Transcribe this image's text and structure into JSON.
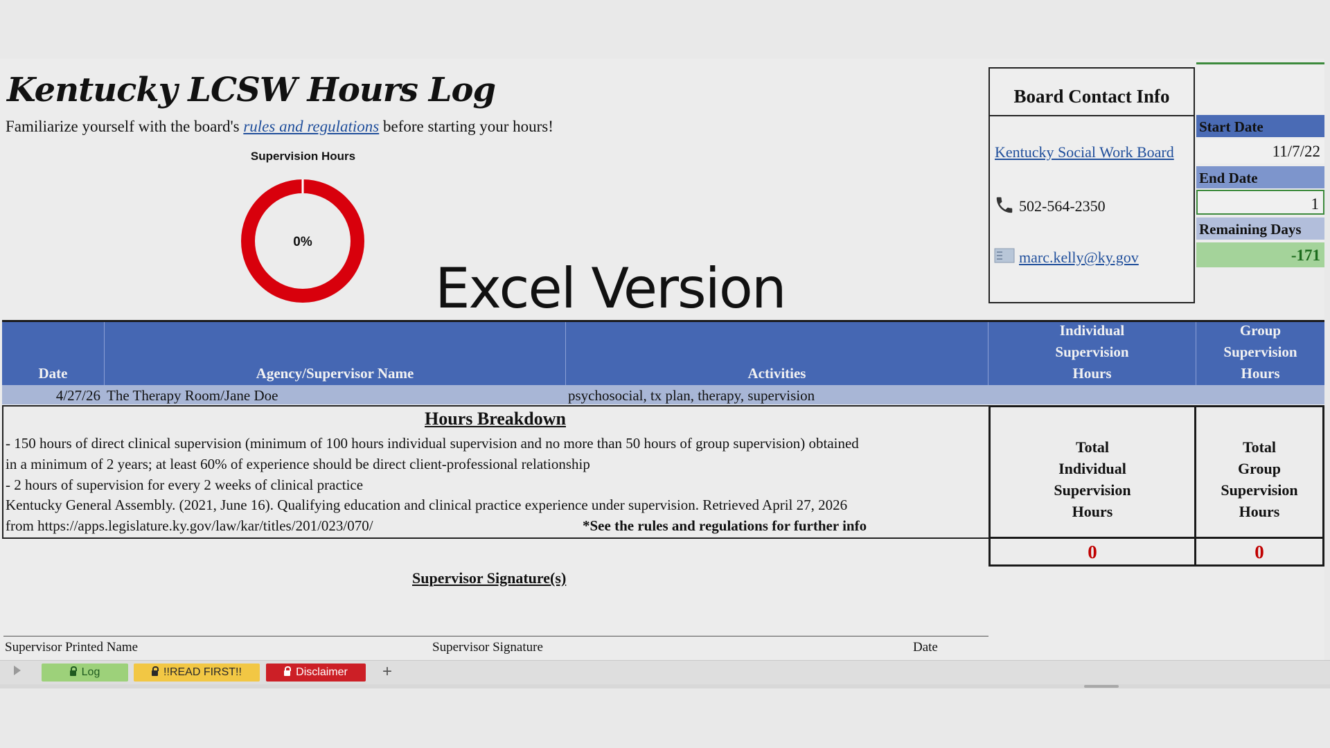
{
  "title": "Kentucky LCSW Hours Log",
  "intro": {
    "prefix": "Familiarize yourself with the board's ",
    "link": "rules and regulations",
    "suffix": " before starting your hours!"
  },
  "chart_data": {
    "type": "pie",
    "title": "Supervision Hours",
    "center_label": "0%",
    "values": [
      0,
      100
    ],
    "colors": [
      "#f0f0f0",
      "#d8000c"
    ]
  },
  "overlay_text": "Excel Version",
  "contact": {
    "heading": "Board Contact Info",
    "board_link": "Kentucky Social Work Board",
    "phone": "502-564-2350",
    "email": "marc.kelly@ky.gov"
  },
  "dates": {
    "start_label": "Start Date",
    "start_value": "11/7/22",
    "end_label": "End Date",
    "end_value": "1",
    "remaining_label": "Remaining Days",
    "remaining_value": "-171"
  },
  "table": {
    "headers": {
      "date": "Date",
      "agency": "Agency/Supervisor Name",
      "activities": "Activities",
      "individual": "Individual\nSupervision\nHours",
      "group": "Group\nSupervision\nHours"
    },
    "rows": [
      {
        "date": "4/27/26",
        "agency": "The Therapy Room/Jane Doe",
        "activities": "psychosocial, tx plan, therapy, supervision",
        "individual": "",
        "group": ""
      }
    ]
  },
  "breakdown": {
    "title": "Hours Breakdown",
    "line1": "- 150 hours of direct clinical supervision (minimum of 100 hours individual supervision and no more than 50 hours of group supervision) obtained",
    "line2": "in a minimum of 2 years; at least 60% of experience should be direct client-professional relationship",
    "line3": "- 2 hours of supervision for every 2 weeks of clinical practice",
    "line4": "Kentucky General Assembly. (2021, June 16). Qualifying education and clinical practice experience under supervision. Retrieved April 27, 2026",
    "line5": "from https://apps.legislature.ky.gov/law/kar/titles/201/023/070/",
    "note": "*See the rules and regulations for further info"
  },
  "totals": {
    "individual_label": "Total\nIndividual\nSupervision\nHours",
    "individual_value": "0",
    "group_label": "Total\nGroup\nSupervision\nHours",
    "group_value": "0"
  },
  "signature": {
    "title": "Supervisor Signature(s)",
    "printed_name": "Supervisor Printed Name",
    "signature": "Supervisor Signature",
    "date": "Date"
  },
  "tabs": [
    {
      "label": "Log",
      "color": "#9dd17a",
      "text": "#1f5a1f"
    },
    {
      "label": "!!READ FIRST!!",
      "color": "#f2c744",
      "text": "#2a2a2a"
    },
    {
      "label": "Disclaimer",
      "color": "#cc1f26",
      "text": "#ffffff"
    }
  ],
  "add_sheet": "+"
}
